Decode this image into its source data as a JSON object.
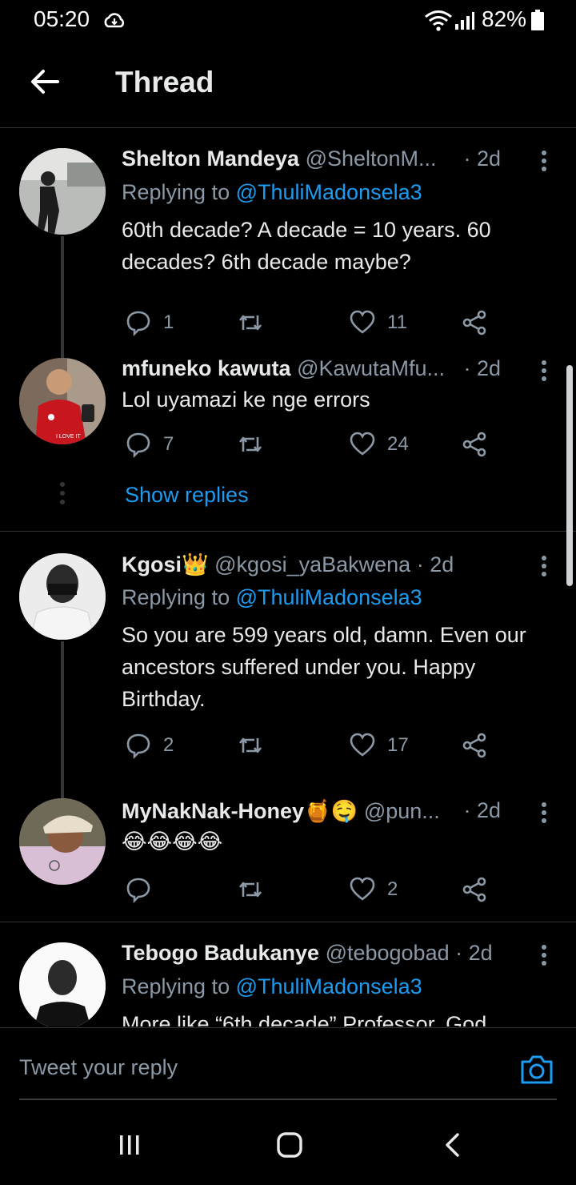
{
  "status_bar": {
    "time": "05:20",
    "battery": "82%"
  },
  "header": {
    "title": "Thread"
  },
  "tweets": [
    {
      "name": "Shelton Mandeya",
      "handle": "@SheltonM...",
      "time": "· 2d",
      "replying_prefix": "Replying to ",
      "replying_to": "@ThuliMadonsela3",
      "text": "60th decade? A decade = 10 years. 60 decades? 6th decade maybe?",
      "replies": "1",
      "retweets": "",
      "likes": "11"
    },
    {
      "name": "mfuneko kawuta",
      "handle": "@KawutaMfu...",
      "time": "· 2d",
      "text": "Lol uyamazi ke nge errors",
      "replies": "7",
      "retweets": "",
      "likes": "24",
      "avatar_caption": "I LOVE IT"
    },
    {
      "name": "Kgosi👑",
      "handle": "@kgosi_yaBakwena",
      "time": "· 2d",
      "replying_prefix": "Replying to ",
      "replying_to": "@ThuliMadonsela3",
      "text": "So you are 599 years old, damn. Even our ancestors suffered under you. Happy Birthday.",
      "replies": "2",
      "retweets": "",
      "likes": "17"
    },
    {
      "name": "MyNakNak-Honey🍯🤤",
      "handle": "@pun...",
      "time": "· 2d",
      "text": "😂😂😂😂",
      "replies": "",
      "retweets": "",
      "likes": "2"
    },
    {
      "name": "Tebogo Badukanye",
      "handle": "@tebogobad",
      "time": "· 2d",
      "replying_prefix": "Replying to ",
      "replying_to": "@ThuliMadonsela3",
      "text": "More like “6th decade” Professor. God"
    }
  ],
  "show_replies": "Show replies",
  "composer": {
    "placeholder": "Tweet your reply"
  },
  "colors": {
    "background": "#000000",
    "accent": "#1d9bf0",
    "muted": "#8b98a5",
    "divider": "#2f3336"
  }
}
